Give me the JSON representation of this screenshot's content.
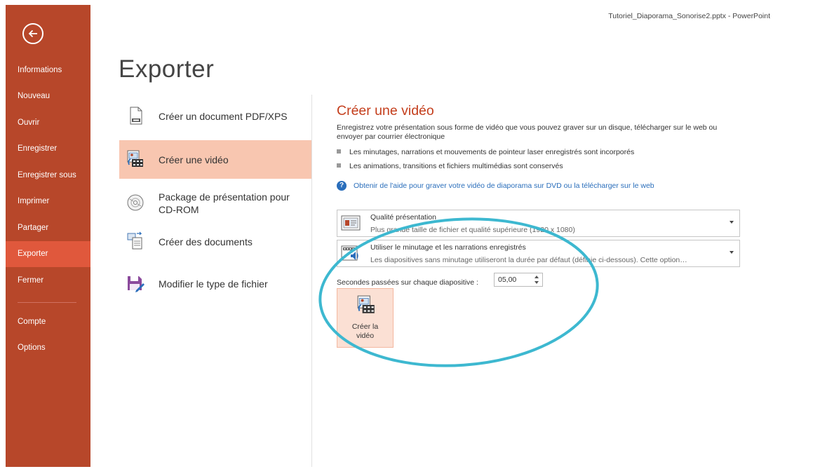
{
  "window": {
    "title": "Tutoriel_Diaporama_Sonorise2.pptx - PowerPoint"
  },
  "colors": {
    "sidebar": "#b7472a",
    "sidebar_active": "#e0583c",
    "accent_title": "#c43e1c",
    "option_selected": "#f8c6b0",
    "link": "#2a6ebb",
    "annotation": "#3db8d0"
  },
  "sidebar": {
    "back_icon": "back-arrow-icon",
    "items": [
      {
        "label": "Informations"
      },
      {
        "label": "Nouveau"
      },
      {
        "label": "Ouvrir"
      },
      {
        "label": "Enregistrer"
      },
      {
        "label": "Enregistrer sous"
      },
      {
        "label": "Imprimer"
      },
      {
        "label": "Partager"
      },
      {
        "label": "Exporter",
        "active": true
      },
      {
        "label": "Fermer"
      },
      {
        "label": "Compte"
      },
      {
        "label": "Options"
      }
    ]
  },
  "page": {
    "title": "Exporter"
  },
  "export_options": [
    {
      "label": "Créer un document PDF/XPS",
      "icon": "pdf-document-icon"
    },
    {
      "label": "Créer une vidéo",
      "icon": "video-icon",
      "selected": true
    },
    {
      "label": "Package de présentation pour CD-ROM",
      "icon": "cd-icon"
    },
    {
      "label": "Créer des documents",
      "icon": "handouts-icon"
    },
    {
      "label": "Modifier le type de fichier",
      "icon": "save-as-icon"
    }
  ],
  "video_panel": {
    "title": "Créer une vidéo",
    "description": "Enregistrez votre présentation sous forme de vidéo que vous pouvez graver sur un disque, télécharger sur le web ou envoyer par courrier électronique",
    "bullets": [
      "Les minutages, narrations et mouvements de pointeur laser enregistrés sont incorporés",
      "Les animations, transitions et fichiers multimédias sont conservés"
    ],
    "help_link": "Obtenir de l'aide pour graver votre vidéo de diaporama sur DVD ou la télécharger sur le web",
    "quality_dropdown": {
      "title": "Qualité présentation",
      "subtitle": "Plus grande taille de fichier et qualité supérieure (1920 x 1080)",
      "icon": "presentation-quality-icon"
    },
    "timing_dropdown": {
      "title": "Utiliser le minutage et les narrations enregistrés",
      "subtitle": "Les diapositives sans minutage utiliseront la durée par défaut (définie ci-dessous). Cette option…",
      "icon": "narration-timing-icon"
    },
    "seconds_label": "Secondes passées sur chaque diapositive :",
    "seconds_value": "05,00",
    "create_button": {
      "label": "Créer la\nvidéo",
      "icon": "create-video-icon"
    }
  }
}
